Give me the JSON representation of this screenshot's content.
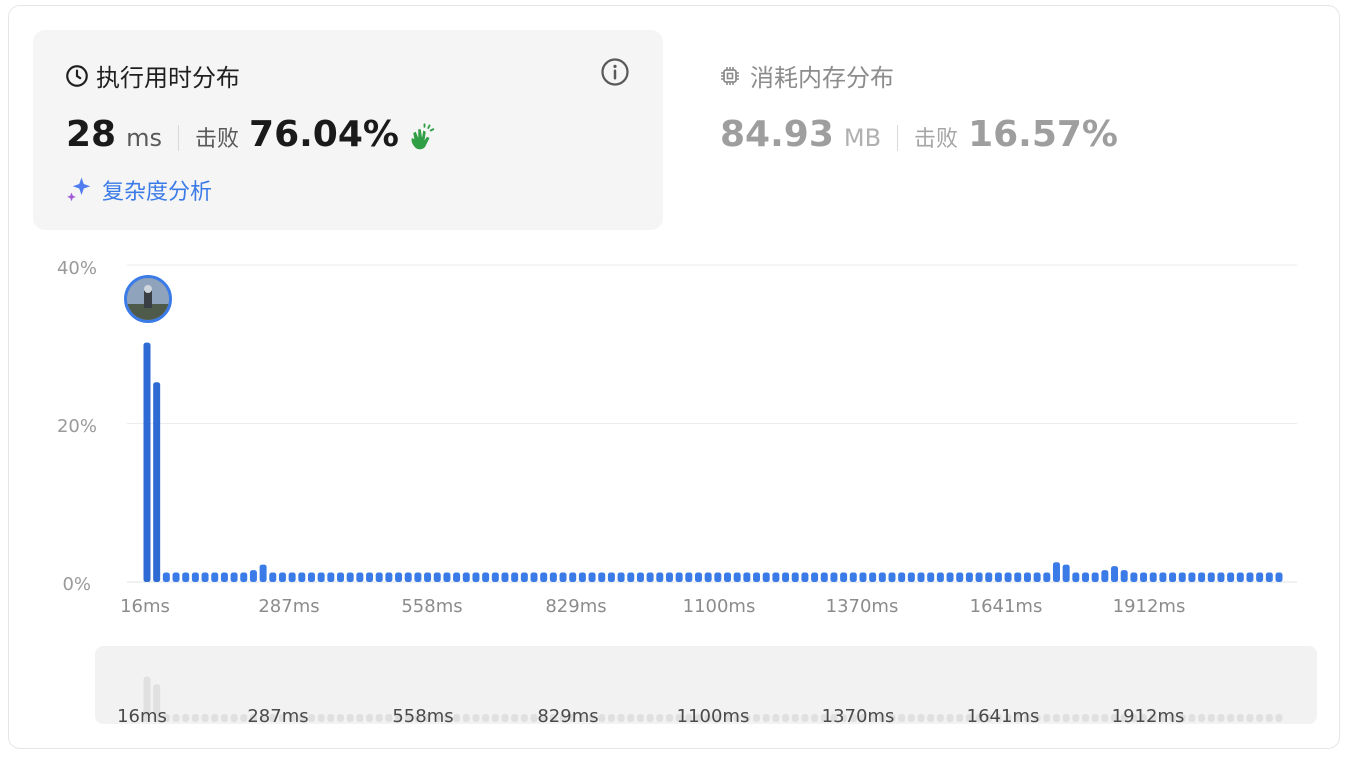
{
  "runtime": {
    "title": "执行用时分布",
    "value": "28",
    "unit": "ms",
    "beat_label": "击败",
    "beat_percent": "76.04%",
    "complexity_link": "复杂度分析"
  },
  "memory": {
    "title": "消耗内存分布",
    "value": "84.93",
    "unit": "MB",
    "beat_label": "击败",
    "beat_percent": "16.57%"
  },
  "colors": {
    "bar": "#3b7be8",
    "bar_dark": "#2d6ad4",
    "mini_bar": "#e0e0e0",
    "grid": "#ececec"
  },
  "icons": [
    "clock-icon",
    "info-icon",
    "clap-icon",
    "sparkle-icon",
    "chip-icon",
    "user-avatar"
  ],
  "chart_data": {
    "type": "bar",
    "ylim": [
      0,
      40
    ],
    "y_ticks": [
      "40%",
      "20%",
      "0%"
    ],
    "x_tick_labels": [
      "16ms",
      "287ms",
      "558ms",
      "829ms",
      "1100ms",
      "1370ms",
      "1641ms",
      "1912ms"
    ],
    "values": [
      30.2,
      25.2,
      1.2,
      1.2,
      1.2,
      1.2,
      1.2,
      1.2,
      1.2,
      1.2,
      1.2,
      1.5,
      2.2,
      1.2,
      1.2,
      1.2,
      1.2,
      1.2,
      1.2,
      1.2,
      1.2,
      1.2,
      1.2,
      1.2,
      1.2,
      1.2,
      1.2,
      1.2,
      1.2,
      1.2,
      1.2,
      1.2,
      1.2,
      1.2,
      1.2,
      1.2,
      1.2,
      1.2,
      1.2,
      1.2,
      1.2,
      1.2,
      1.2,
      1.2,
      1.2,
      1.2,
      1.2,
      1.2,
      1.2,
      1.2,
      1.2,
      1.2,
      1.2,
      1.2,
      1.2,
      1.2,
      1.2,
      1.2,
      1.2,
      1.2,
      1.2,
      1.2,
      1.2,
      1.2,
      1.2,
      1.2,
      1.2,
      1.2,
      1.2,
      1.2,
      1.2,
      1.2,
      1.2,
      1.2,
      1.2,
      1.2,
      1.2,
      1.2,
      1.2,
      1.2,
      1.2,
      1.2,
      1.2,
      1.2,
      1.2,
      1.2,
      1.2,
      1.2,
      1.2,
      1.2,
      1.2,
      1.2,
      1.2,
      1.2,
      2.5,
      2.2,
      1.2,
      1.2,
      1.2,
      1.5,
      2.0,
      1.5,
      1.2,
      1.2,
      1.2,
      1.2,
      1.2,
      1.2,
      1.2,
      1.2,
      1.2,
      1.2,
      1.2,
      1.2,
      1.2,
      1.2,
      1.2,
      1.2
    ],
    "highlight_index": 1
  }
}
